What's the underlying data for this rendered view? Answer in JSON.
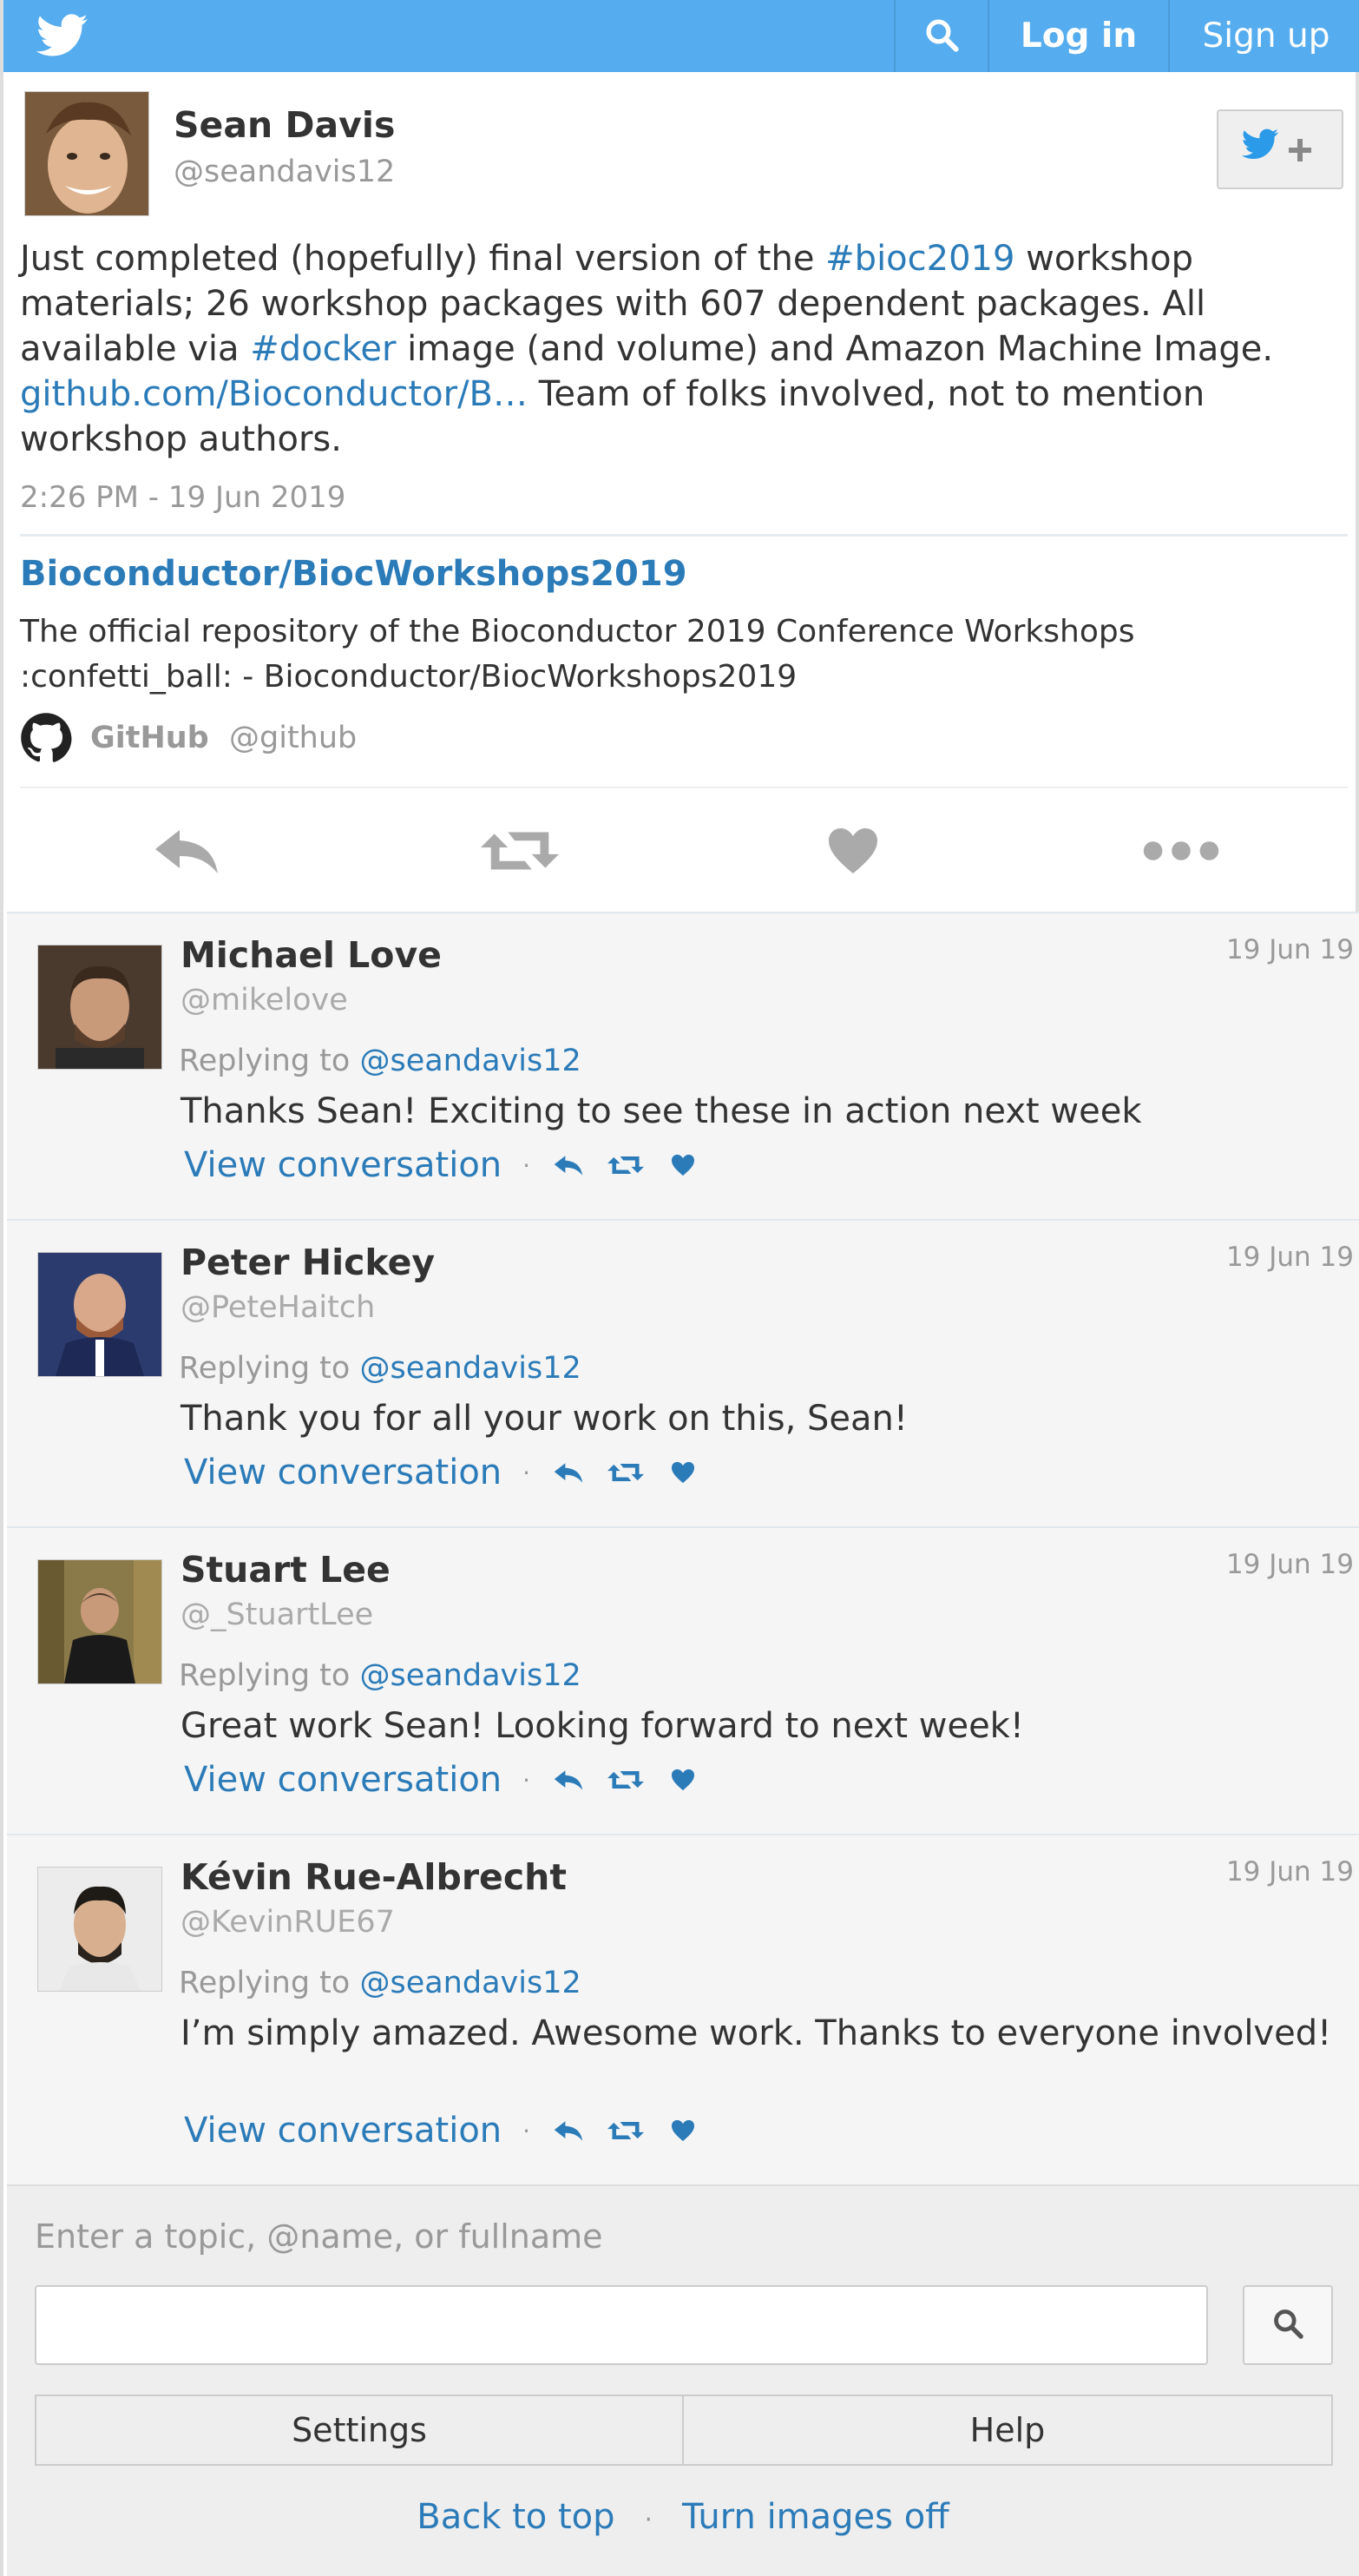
{
  "topbar": {
    "logo_icon": "twitter-bird-icon",
    "search_icon": "search-icon",
    "login_label": "Log in",
    "signup_label": "Sign up",
    "bar_color": "#55acee"
  },
  "tweet": {
    "author": {
      "name": "Sean Davis",
      "handle": "@seandavis12"
    },
    "follow_icon": "follow-bird-plus-icon",
    "text": {
      "part1": "Just completed (hopefully) final version of the ",
      "hashtag1": "#bioc2019",
      "part2": " workshop materials; 26 workshop packages with 607 dependent packages. All available via ",
      "hashtag2": "#docker",
      "part3": " image (and volume) and Amazon Machine Image. ",
      "link": "github.com/Bioconductor/B…",
      "part4": " Team of folks involved, not to mention workshop authors."
    },
    "timestamp": "2:26 PM - 19 Jun 2019",
    "card": {
      "title": "Bioconductor/BiocWorkshops2019",
      "description": "The official repository of the Bioconductor 2019 Conference Workshops :confetti_ball: - Bioconductor/BiocWorkshops2019",
      "source_icon": "github-icon",
      "source_name": "GitHub",
      "source_handle": "@github"
    },
    "actions": [
      "reply-icon",
      "retweet-icon",
      "like-icon",
      "more-icon"
    ]
  },
  "replies": [
    {
      "name": "Michael Love",
      "handle": "@mikelove",
      "date": "19 Jun 19",
      "replying_prefix": "Replying to ",
      "replying_to": "@seandavis12",
      "text": "Thanks Sean! Exciting to see these in action next week",
      "view_label": "View conversation",
      "separator": "·"
    },
    {
      "name": "Peter Hickey",
      "handle": "@PeteHaitch",
      "date": "19 Jun 19",
      "replying_prefix": "Replying to ",
      "replying_to": "@seandavis12",
      "text": "Thank you for all your work on this, Sean!",
      "view_label": "View conversation",
      "separator": "·"
    },
    {
      "name": "Stuart Lee",
      "handle": "@_StuartLee",
      "date": "19 Jun 19",
      "replying_prefix": "Replying to ",
      "replying_to": "@seandavis12",
      "text": "Great work Sean! Looking forward to next week!",
      "view_label": "View conversation",
      "separator": "·"
    },
    {
      "name": "Kévin Rue-Albrecht",
      "handle": "@KevinRUE67",
      "date": "19 Jun 19",
      "replying_prefix": "Replying to ",
      "replying_to": "@seandavis12",
      "text": "I’m simply amazed. Awesome work. Thanks to everyone involved!",
      "view_label": "View conversation",
      "separator": "·"
    }
  ],
  "footer": {
    "search_label": "Enter a topic, @name, or fullname",
    "search_value": "",
    "settings_label": "Settings",
    "help_label": "Help",
    "back_to_top": "Back to top",
    "link_separator": "·",
    "images_off": "Turn images off"
  },
  "colors": {
    "link": "#2b7bb9",
    "reply_bg": "#f5f5f5",
    "footer_bg": "#eeeeee",
    "muted": "#999999"
  }
}
